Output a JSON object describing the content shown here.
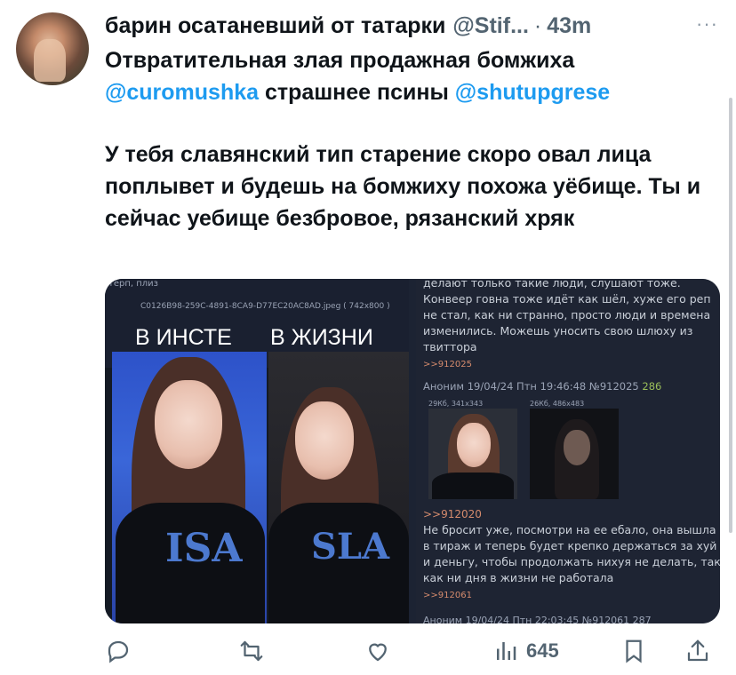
{
  "tweet": {
    "author_name": "барин осатаневший от татарки",
    "author_handle": "@Stif...",
    "separator": "·",
    "timestamp": "43m",
    "more_label": "···",
    "lines": {
      "line1": "Отвратительная злая продажная бомжиха",
      "mention1": "@curomushka",
      "line2_mid": " страшнее псины ",
      "mention2": "@shutupgrese",
      "para": "У тебя славянский тип старение скоро овал лица поплывет и будешь на бомжиху похожа уёбище. Ты и сейчас уебище безбровое, рязанский хряк"
    }
  },
  "media": {
    "left": {
      "top_text": "терп, плиз",
      "file_name": "C0126B98-259C-4891-8CA9-D77EC20AC8AD.jpeg ( 742x800 )",
      "label_in": "В ИНСТЕ",
      "label_life": "В ЖИЗНИ"
    },
    "right": {
      "block1": "делают только такие люди, слушают тоже. Конвеер говна тоже идёт как шёл, хуже его реп не стал, как ни странно, просто люди и времена изменились. Можешь уносить свою шлюху из твиттора",
      "block1_reply": ">>912025",
      "post_header": "Аноним 19/04/24 Птн 19:46:48 №912025",
      "post_count": "286",
      "thumb1_caption": "29Кб, 341x343",
      "thumb2_caption": "26Кб, 486x483",
      "quote": ">>912020",
      "block2": "Не бросит уже, посмотри на ее ебало, она вышла в тираж и теперь будет крепко держаться за хуй и деньгу, чтобы продолжать нихуя не делать, так как ни дня в жизни не работала",
      "block2_reply": ">>912061",
      "footer_header": "Аноним 19/04/24 Птн 22:03:45 №912061 287"
    }
  },
  "actions": {
    "views_count": "645"
  },
  "colors": {
    "mention": "#1d9bf0",
    "secondary_text": "#536471"
  }
}
